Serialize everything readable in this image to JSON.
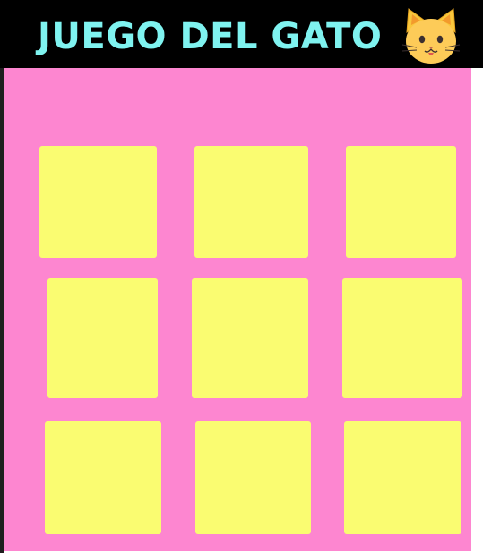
{
  "header": {
    "title": "JUEGO DEL GATO",
    "title_color": "#7ff3f0",
    "background_color": "#000000",
    "icon": "cat-face-icon"
  },
  "board": {
    "background_color": "#fd86d0",
    "cell_color": "#fafc71",
    "rows": 3,
    "columns": 3,
    "cells": [
      "",
      "",
      "",
      "",
      "",
      "",
      "",
      "",
      ""
    ]
  }
}
